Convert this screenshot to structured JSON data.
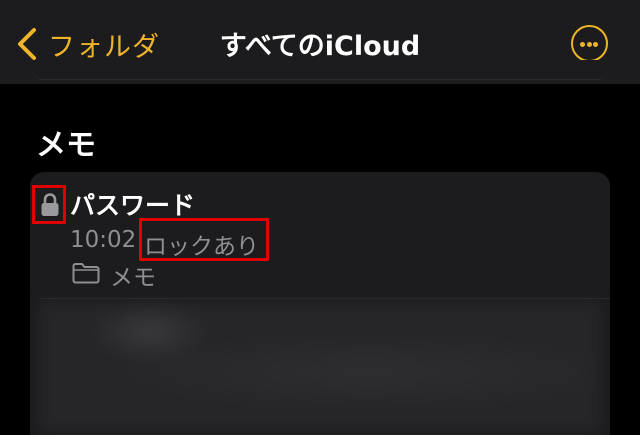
{
  "navbar": {
    "back_label": "フォルダ",
    "title": "すべてのiCloud",
    "more_icon": "ellipsis-circle-icon"
  },
  "section": {
    "title": "メモ"
  },
  "note": {
    "title": "パスワード",
    "time": "10:02",
    "status": "ロックあり",
    "folder": "メモ",
    "locked": true
  },
  "colors": {
    "accent": "#f0b429",
    "background": "#000000",
    "card": "#1c1c1e",
    "secondary_text": "#8e8e93",
    "highlight": "#e00000"
  }
}
